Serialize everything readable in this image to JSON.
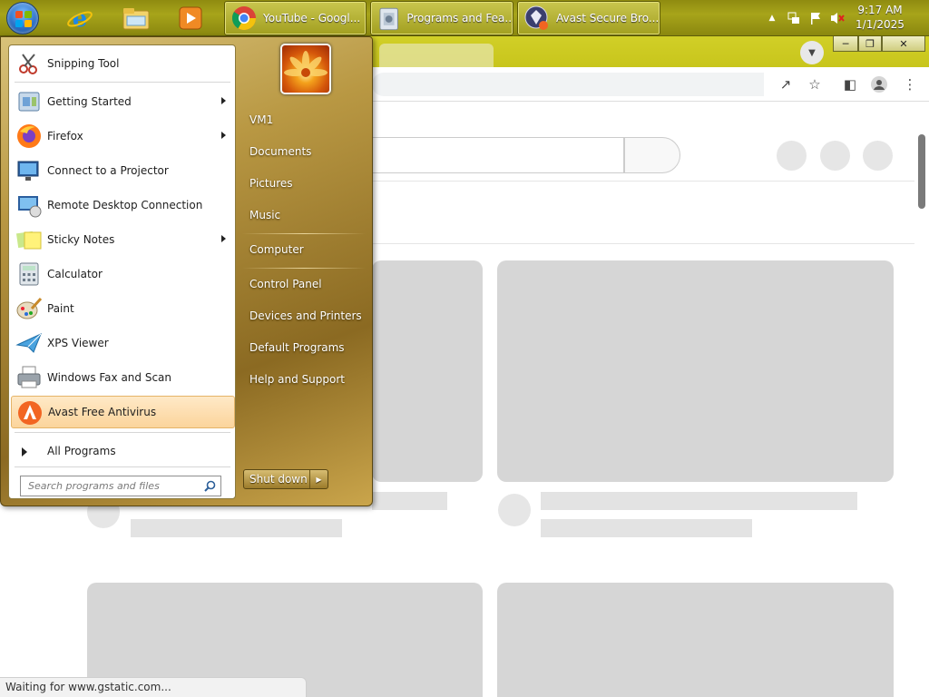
{
  "taskbar": {
    "tasks": [
      {
        "label": "YouTube - Googl...",
        "icon": "chrome-icon"
      },
      {
        "label": "Programs and Fea...",
        "icon": "programs-features-icon"
      },
      {
        "label": "Avast Secure Bro...",
        "icon": "avast-secure-browser-icon"
      }
    ],
    "clock": {
      "time": "9:17 AM",
      "date": "1/1/2025"
    },
    "pinned": [
      "internet-explorer-icon",
      "windows-explorer-icon",
      "media-player-icon"
    ]
  },
  "browser": {
    "status_text": "Waiting for www.gstatic.com..."
  },
  "start_menu": {
    "programs": [
      {
        "label": "Snipping Tool",
        "has_submenu": false
      },
      {
        "label": "Getting Started",
        "has_submenu": true
      },
      {
        "label": "Firefox",
        "has_submenu": true
      },
      {
        "label": "Connect to a Projector",
        "has_submenu": false
      },
      {
        "label": "Remote Desktop Connection",
        "has_submenu": false
      },
      {
        "label": "Sticky Notes",
        "has_submenu": true
      },
      {
        "label": "Calculator",
        "has_submenu": false
      },
      {
        "label": "Paint",
        "has_submenu": false
      },
      {
        "label": "XPS Viewer",
        "has_submenu": false
      },
      {
        "label": "Windows Fax and Scan",
        "has_submenu": false
      },
      {
        "label": "Avast Free Antivirus",
        "has_submenu": false,
        "highlighted": true
      }
    ],
    "all_programs": "All Programs",
    "search_placeholder": "Search programs and files",
    "right_links": [
      "VM1",
      "Documents",
      "Pictures",
      "Music",
      "Computer",
      "Control Panel",
      "Devices and Printers",
      "Default Programs",
      "Help and Support"
    ],
    "shutdown": "Shut down"
  },
  "colors": {
    "taskbar": "#a7a41a",
    "highlight": "#fbd49b",
    "menu_glass": "#b99843"
  }
}
